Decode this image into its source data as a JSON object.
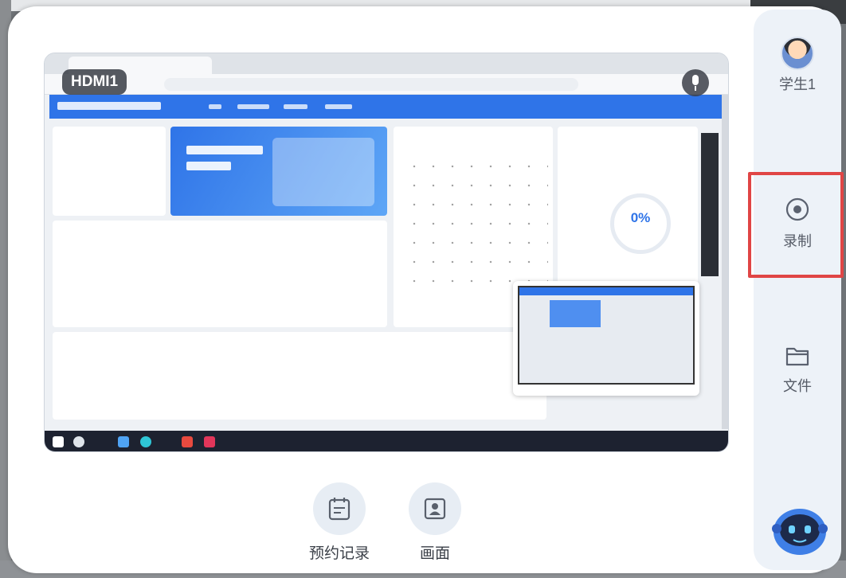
{
  "screen": {
    "source_label": "HDMI1",
    "progress_text": "0%"
  },
  "sidebar": {
    "user": {
      "label": "学生1",
      "icon": "student-avatar-icon"
    },
    "record": {
      "label": "录制",
      "icon": "record-icon"
    },
    "files": {
      "label": "文件",
      "icon": "folder-icon"
    },
    "assistant": {
      "icon": "robot-assistant-icon"
    }
  },
  "actions": {
    "booking_records": {
      "label": "预约记录",
      "icon": "calendar-list-icon"
    },
    "picture": {
      "label": "画面",
      "icon": "person-frame-icon"
    }
  },
  "colors": {
    "accent": "#2f74e8",
    "highlight": "#e04545",
    "sidebar_bg": "#edf2f8"
  }
}
